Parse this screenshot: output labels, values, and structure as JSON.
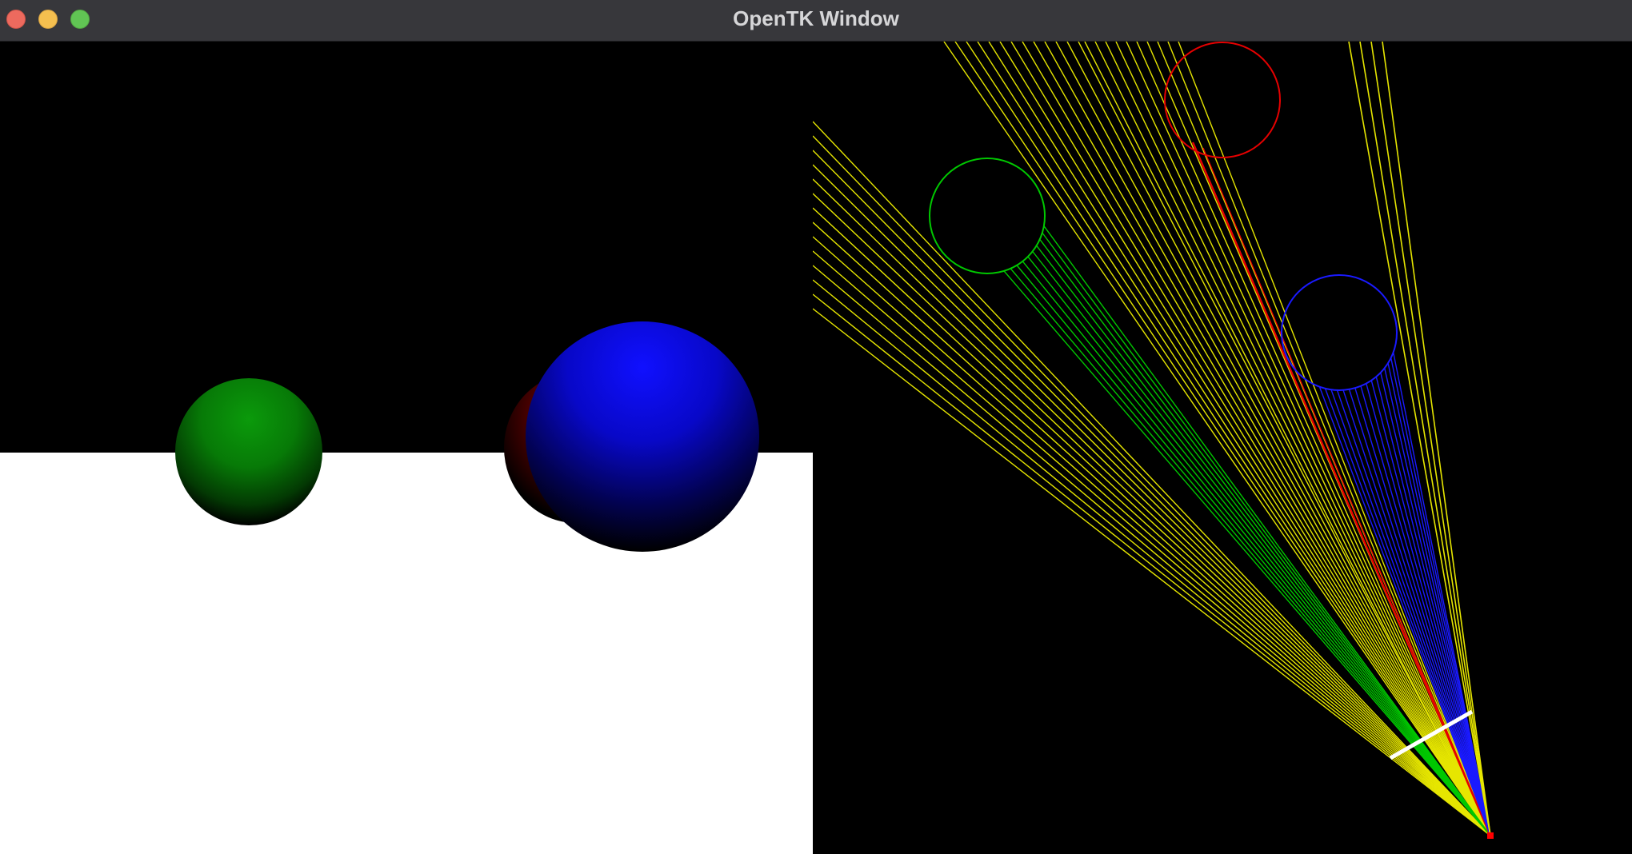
{
  "window": {
    "title": "OpenTK Window"
  },
  "colors": {
    "titlebar": "#37373b",
    "close": "#ed6a5e",
    "minimize": "#f5bf4f",
    "maximize": "#61c554",
    "floor": "#ffffff",
    "sky": "#000000",
    "green_sphere": "#0a8a0a",
    "red_sphere": "#8a0000",
    "blue_sphere": "#1010ff",
    "ray_yellow": "#e6e600",
    "ray_green": "#00c800",
    "ray_blue": "#1a1aff",
    "ray_red": "#e60000",
    "screen_plane": "#ffffff",
    "camera_point": "#ff0000"
  },
  "render_view": {
    "objects": [
      "floor-plane",
      "green-sphere",
      "red-sphere",
      "blue-sphere"
    ]
  },
  "ray_view": {
    "objects": [
      "green-circle",
      "red-circle",
      "blue-circle",
      "view-plane-segment",
      "camera-origin"
    ]
  }
}
